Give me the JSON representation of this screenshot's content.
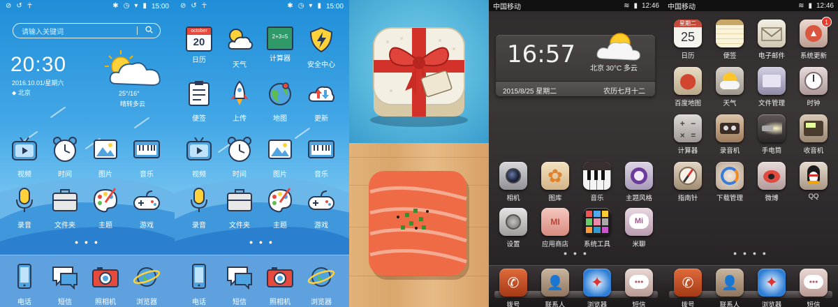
{
  "screen1": {
    "status_time": "15:00",
    "search_placeholder": "请输入关键词",
    "clock": "20:30",
    "date": "2016.10.01/星期六",
    "city": "北京",
    "temp": "25°/16°",
    "condition": "晴转多云",
    "page_dots": "● ● ●",
    "apps": [
      "视频",
      "时间",
      "图片",
      "音乐",
      "录音",
      "文件夹",
      "主题",
      "游戏"
    ],
    "dock": [
      "电话",
      "短信",
      "照相机",
      "浏览器"
    ]
  },
  "screen2": {
    "status_time": "15:00",
    "calendar_month": "october",
    "calendar_day": "20",
    "calc_display": "2+3=5",
    "apps": [
      "日历",
      "天气",
      "计算器",
      "安全中心",
      "便签",
      "上传",
      "地图",
      "更新",
      "视频",
      "时间",
      "图片",
      "音乐",
      "录音",
      "文件夹",
      "主题",
      "游戏"
    ],
    "page_dots": "● ● ●",
    "dock": [
      "电话",
      "短信",
      "照相机",
      "浏览器"
    ]
  },
  "screen4": {
    "carrier": "中国移动",
    "status_time": "12:46",
    "widget_time": "16:57",
    "widget_weather": "北京 30°C 多云",
    "widget_date": "2015/8/25 星期二",
    "widget_lunar": "农历七月十二",
    "apps": [
      "相机",
      "图库",
      "音乐",
      "主题风格",
      "设置",
      "应用商店",
      "系统工具",
      "米聊"
    ],
    "page_dots": "● ● ●",
    "dock": [
      "拨号",
      "联系人",
      "浏览器",
      "短信"
    ]
  },
  "screen5": {
    "carrier": "中国移动",
    "status_time": "12:46",
    "calendar_weekday": "星期二",
    "calendar_day": "25",
    "update_badge": "1",
    "apps": [
      "日历",
      "便签",
      "电子邮件",
      "系统更新",
      "百度地图",
      "天气",
      "文件管理",
      "时钟",
      "计算器",
      "录音机",
      "手电筒",
      "收音机",
      "指南针",
      "下载管理",
      "微博",
      "QQ"
    ],
    "page_dots": "● ● ● ●",
    "dock": [
      "拨号",
      "联系人",
      "浏览器",
      "短信"
    ]
  },
  "colors": {
    "blue_top": "#1f8ed8",
    "blue_bottom": "#9bd3f5",
    "dark_bg": "#2f2b2c",
    "badge_red": "#e23b2e"
  }
}
